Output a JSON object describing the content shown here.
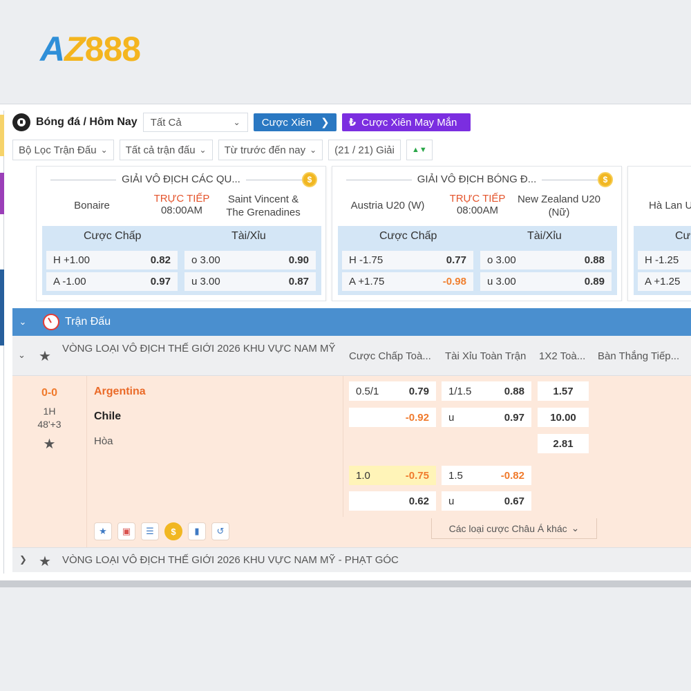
{
  "brand": {
    "logo_a": "A",
    "logo_z": "Z",
    "logo_num": "888"
  },
  "toolbar": {
    "breadcrumb": "Bóng đá / Hôm Nay",
    "sport_select": "Tất Cả",
    "parlay_button": "Cược Xiên",
    "lucky_parlay_button": "Cược Xiên May Mắn"
  },
  "filters": {
    "match_filter": "Bộ Lọc Trận Đấu",
    "all_matches": "Tất cả trận đấu",
    "time_filter": "Từ trước đến nay",
    "league_count": "(21 / 21) Giải"
  },
  "featured": [
    {
      "title": "GIẢI VÔ ĐỊCH CÁC QU...",
      "home": "Bonaire",
      "status": "TRỰC TIẾP",
      "time": "08:00AM",
      "away_line1": "Saint Vincent &",
      "away_line2": "The Grenadines",
      "handicap_label": "Cược Chấp",
      "ou_label": "Tài/Xỉu",
      "h_line": "H +1.00",
      "h_odds": "0.82",
      "a_line": "A -1.00",
      "a_odds": "0.97",
      "o_line": "o 3.00",
      "o_odds": "0.90",
      "u_line": "u 3.00",
      "u_odds": "0.87"
    },
    {
      "title": "GIẢI VÔ ĐỊCH BÓNG Đ...",
      "home": "Austria U20 (W)",
      "status": "TRỰC TIẾP",
      "time": "08:00AM",
      "away_line1": "New Zealand U20",
      "away_line2": "(Nữ)",
      "handicap_label": "Cược Chấp",
      "ou_label": "Tài/Xỉu",
      "h_line": "H -1.75",
      "h_odds": "0.77",
      "a_line": "A +1.75",
      "a_odds": "-0.98",
      "o_line": "o 3.00",
      "o_odds": "0.88",
      "u_line": "u 3.00",
      "u_odds": "0.89"
    },
    {
      "home": "Hà Lan U",
      "handicap_label": "Cư",
      "h_line": "H -1.25",
      "a_line": "A +1.25"
    }
  ],
  "section": {
    "title": "Trận Đấu"
  },
  "league": {
    "name": "VÒNG LOẠI VÔ ĐỊCH THẾ GIỚI 2026 KHU VỰC NAM MỸ",
    "col_handicap": "Cược Chấp Toà...",
    "col_ou": "Tài Xỉu Toàn Trận",
    "col_1x2": "1X2 Toà...",
    "col_next_goal": "Bàn Thắng Tiếp..."
  },
  "match": {
    "score": "0-0",
    "period": "1H",
    "minute": "48'+3",
    "home": "Argentina",
    "away": "Chile",
    "draw": "Hòa",
    "hdp_main_line": "0.5/1",
    "hdp_main_home": "0.79",
    "hdp_main_away": "-0.92",
    "ou_main_line": "1/1.5",
    "ou_main_over": "0.88",
    "ou_main_u": "u",
    "ou_main_under": "0.97",
    "x12_home": "1.57",
    "x12_away": "10.00",
    "x12_draw": "2.81",
    "hdp_alt_line": "1.0",
    "hdp_alt_home": "-0.75",
    "hdp_alt_away": "0.62",
    "ou_alt_line": "1.5",
    "ou_alt_over": "-0.82",
    "ou_alt_u": "u",
    "ou_alt_under": "0.67",
    "more_asian": "Các loại cược Châu Á khác"
  },
  "league2": {
    "name": "VÒNG LOẠI VÔ ĐỊCH THẾ GIỚI 2026 KHU VỰC NAM MỸ - PHẠT GÓC"
  }
}
